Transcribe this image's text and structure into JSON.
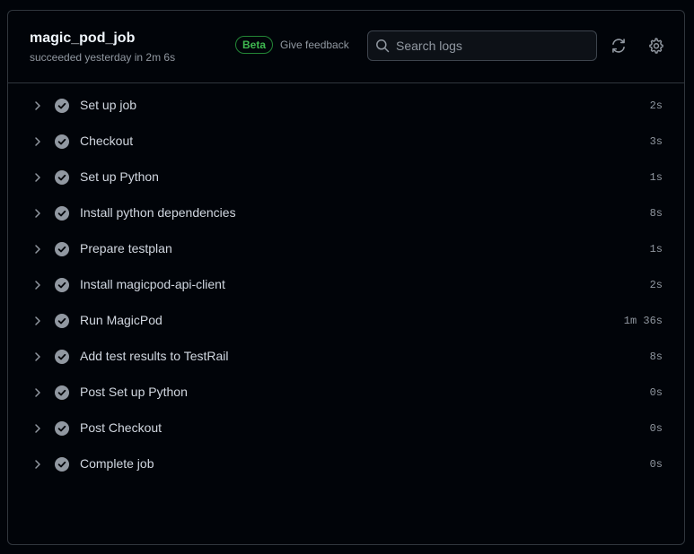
{
  "job": {
    "title": "magic_pod_job",
    "subtitle": "succeeded yesterday in 2m 6s"
  },
  "header": {
    "beta_label": "Beta",
    "feedback_label": "Give feedback",
    "search_placeholder": "Search logs",
    "icons": [
      "search-icon",
      "refresh-icon",
      "gear-icon"
    ]
  },
  "steps": [
    {
      "name": "Set up job",
      "duration": "2s"
    },
    {
      "name": "Checkout",
      "duration": "3s"
    },
    {
      "name": "Set up Python",
      "duration": "1s"
    },
    {
      "name": "Install python dependencies",
      "duration": "8s"
    },
    {
      "name": "Prepare testplan",
      "duration": "1s"
    },
    {
      "name": "Install magicpod-api-client",
      "duration": "2s"
    },
    {
      "name": "Run MagicPod",
      "duration": "1m 36s"
    },
    {
      "name": "Add test results to TestRail",
      "duration": "8s"
    },
    {
      "name": "Post Set up Python",
      "duration": "0s"
    },
    {
      "name": "Post Checkout",
      "duration": "0s"
    },
    {
      "name": "Complete job",
      "duration": "0s"
    }
  ],
  "colors": {
    "background": "#010409",
    "border": "#30363d",
    "success_badge": "#3fb950",
    "step_check": "#9198a1"
  }
}
